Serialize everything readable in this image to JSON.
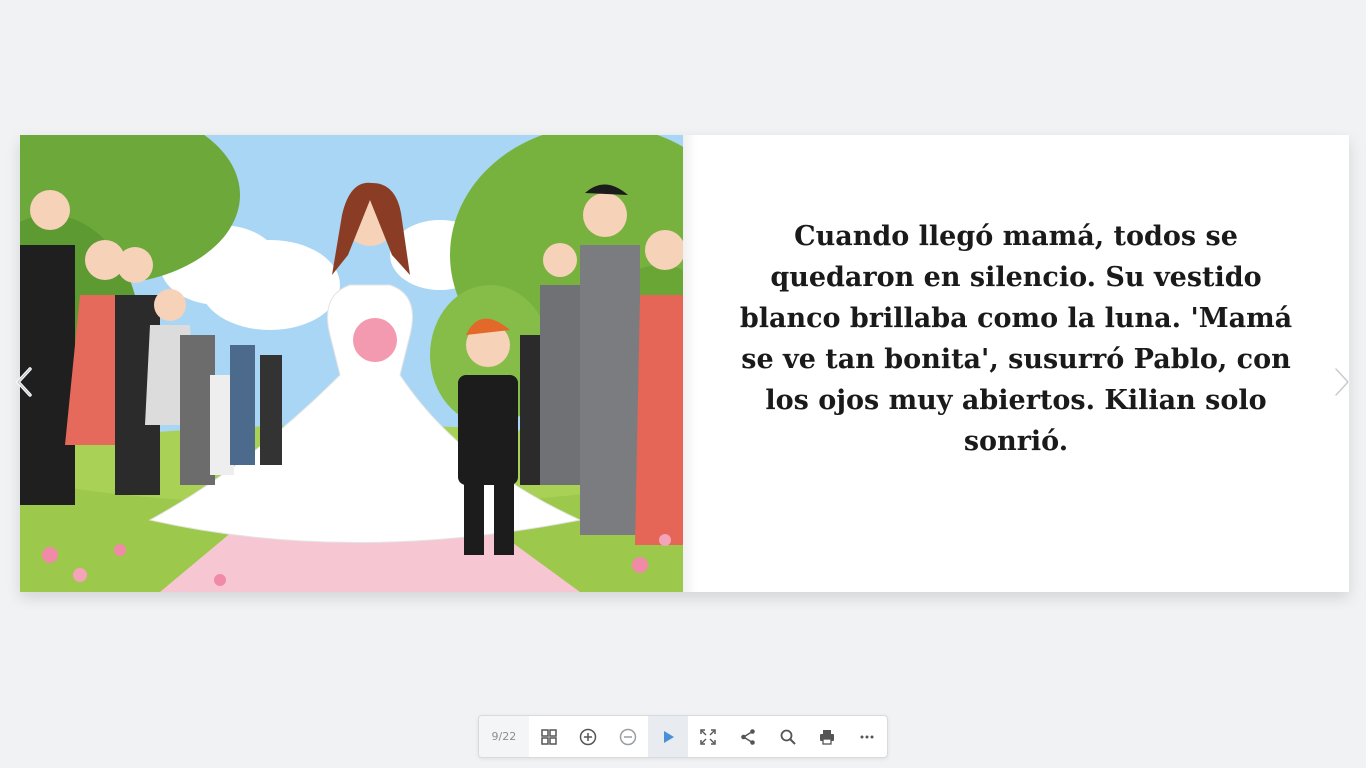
{
  "book": {
    "page_text": "Cuando llegó mamá, todos se quedaron en silencio. Su vestido blanco brillaba como la luna. 'Mamá se ve tan bonita', susurró Pablo, con los ojos muy abiertos. Kilian solo sonrió.",
    "illustration_icon": "wedding-illustration"
  },
  "navigation": {
    "prev_icon": "chevron-left-icon",
    "next_icon": "chevron-right-icon"
  },
  "toolbar": {
    "page_counter": "9/22",
    "buttons": [
      "grid-icon",
      "zoom-in-icon",
      "zoom-out-icon",
      "play-icon",
      "fullscreen-icon",
      "share-icon",
      "search-icon",
      "print-icon",
      "more-icon"
    ]
  },
  "colors": {
    "background": "#f1f2f4",
    "accent": "#4a90d9",
    "text": "#1a1a1a"
  }
}
